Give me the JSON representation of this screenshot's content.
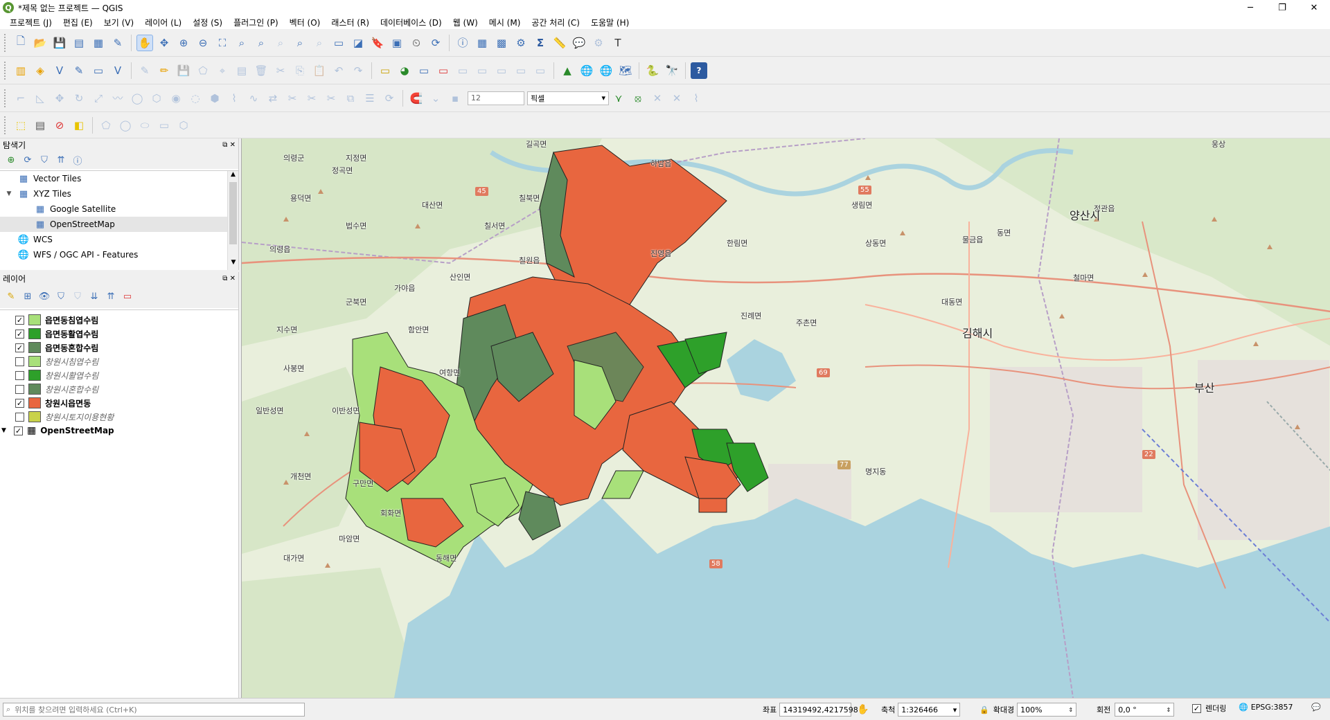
{
  "window": {
    "title": "*제목 없는 프로젝트 — QGIS",
    "minimize": "─",
    "maximize": "❐",
    "close": "✕"
  },
  "menu": [
    "프로젝트 (J)",
    "편집 (E)",
    "보기 (V)",
    "레이어 (L)",
    "설정 (S)",
    "플러그인 (P)",
    "벡터 (O)",
    "래스터 (R)",
    "데이터베이스 (D)",
    "웹 (W)",
    "메시 (M)",
    "공간 처리 (C)",
    "도움말 (H)"
  ],
  "snapping": {
    "tolerance": "12",
    "unit": "픽셀"
  },
  "browser": {
    "title": "탐색기",
    "items": [
      {
        "label": "Vector Tiles",
        "icon": "grid-icon",
        "indent": 0,
        "twisty": ""
      },
      {
        "label": "XYZ Tiles",
        "icon": "grid-icon",
        "indent": 0,
        "twisty": "▼"
      },
      {
        "label": "Google Satellite",
        "icon": "tile-icon",
        "indent": 1,
        "twisty": ""
      },
      {
        "label": "OpenStreetMap",
        "icon": "tile-icon",
        "indent": 1,
        "twisty": ""
      },
      {
        "label": "WCS",
        "icon": "globe-icon",
        "indent": 0,
        "twisty": ""
      },
      {
        "label": "WFS / OGC API - Features",
        "icon": "globe-icon",
        "indent": 0,
        "twisty": ""
      }
    ]
  },
  "layers": {
    "title": "레이어",
    "items": [
      {
        "label": "읍면동침엽수림",
        "checked": true,
        "swatch": "#a8e07a",
        "indent": 1
      },
      {
        "label": "읍면동활엽수림",
        "checked": true,
        "swatch": "#2ea02a",
        "indent": 1
      },
      {
        "label": "읍면동혼합수림",
        "checked": true,
        "swatch": "#5f8a5c",
        "indent": 1
      },
      {
        "label": "창원시침엽수림",
        "checked": false,
        "swatch": "#a8e07a",
        "indent": 1
      },
      {
        "label": "창원시활엽수림",
        "checked": false,
        "swatch": "#2ea02a",
        "indent": 1
      },
      {
        "label": "창원시혼합수림",
        "checked": false,
        "swatch": "#5f8a5c",
        "indent": 1
      },
      {
        "label": "창원시읍면동",
        "checked": true,
        "swatch": "#e8663f",
        "indent": 1
      },
      {
        "label": "창원시토지이용현황",
        "checked": false,
        "swatch": "#c9d24a",
        "indent": 1
      },
      {
        "label": "OpenStreetMap",
        "checked": true,
        "swatch": "",
        "indent": 0
      }
    ]
  },
  "map": {
    "places": [
      "의령군",
      "지정면",
      "길곡면",
      "하남읍",
      "정곡면",
      "칠북면",
      "대산면",
      "용덕면",
      "법수면",
      "생림면",
      "칠서면",
      "칠원읍",
      "진영읍",
      "한림면",
      "상동면",
      "의령읍",
      "가야읍",
      "산인면",
      "군북면",
      "진례면",
      "지수면",
      "함안면",
      "주촌면",
      "사봉면",
      "여항면",
      "일반성면",
      "이반성면",
      "개천면",
      "구만면",
      "회화면",
      "마암면",
      "대가면",
      "동해면",
      "명지동",
      "대동면",
      "물금읍",
      "동면",
      "정관읍",
      "철마면",
      "웅상"
    ],
    "cities": [
      "김해시",
      "양산시",
      "부산"
    ],
    "roads": [
      "45",
      "55",
      "69",
      "58",
      "22",
      "77"
    ]
  },
  "status": {
    "locator_placeholder": "위치를 찾으려면 입력하세요 (Ctrl+K)",
    "coord_label": "좌표",
    "coord": "14319492,4217598",
    "scale_label": "축척",
    "scale": "1:326466",
    "magnifier_label": "확대경",
    "magnifier": "100%",
    "rotation_label": "회전",
    "rotation": "0,0 °",
    "render_label": "렌더링",
    "crs": "EPSG:3857"
  }
}
